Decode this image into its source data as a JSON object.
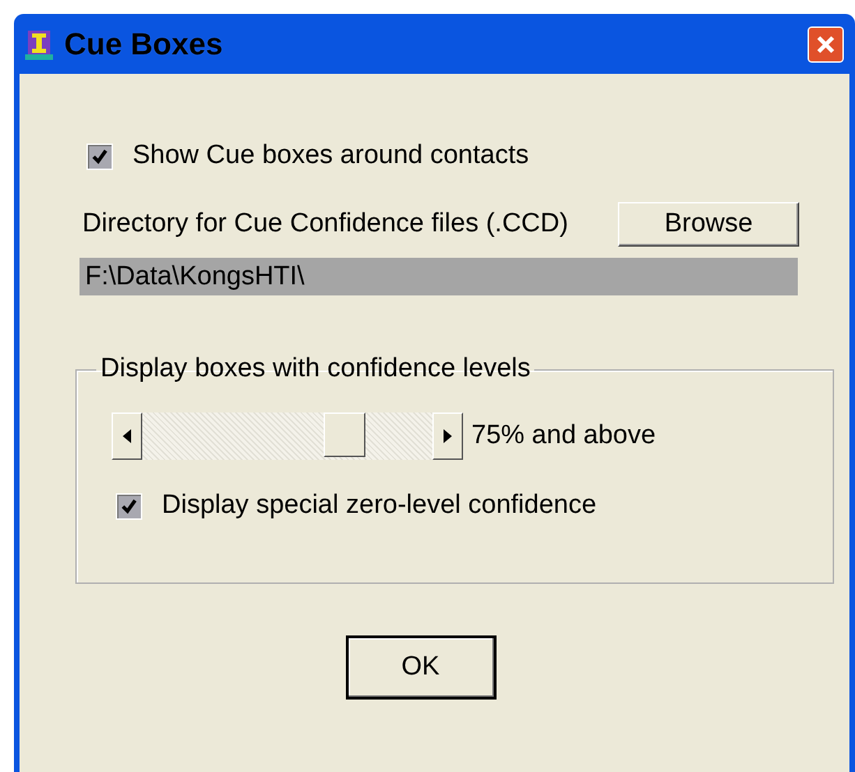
{
  "window": {
    "title": "Cue Boxes"
  },
  "show_cue_boxes": {
    "label": "Show Cue boxes around contacts",
    "checked": true
  },
  "directory": {
    "label": "Directory for Cue Confidence files (.CCD)",
    "browse_button": "Browse",
    "value": "F:\\Data\\KongsHTI\\"
  },
  "confidence_group": {
    "title": "Display boxes with confidence levels",
    "slider": {
      "level": 0.73
    },
    "reading": "75% and above",
    "zero_level": {
      "label": "Display special zero-level confidence",
      "checked": true
    }
  },
  "buttons": [
    "OK"
  ]
}
